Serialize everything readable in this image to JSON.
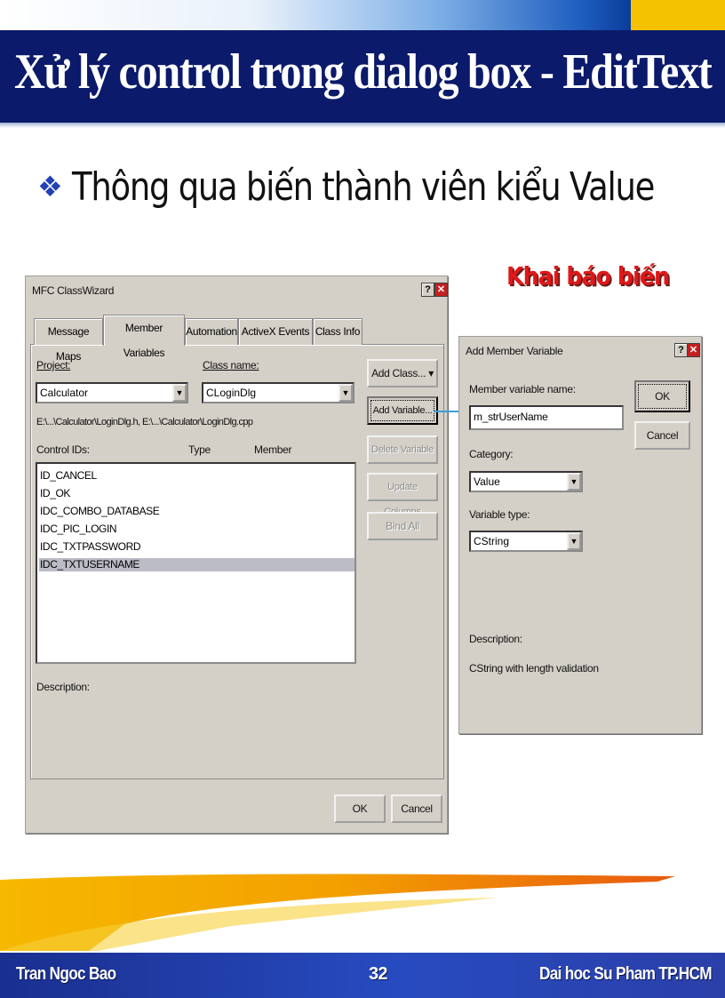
{
  "slide": {
    "title": "Xử lý control trong dialog box - EditText",
    "bullet_icon": "diamond-bullet-icon",
    "bullet": "Thông qua biến thành viên kiểu Value",
    "annotation": "Khai báo biến",
    "colors": {
      "title_bg": "#0b1a6a",
      "annotation": "#e01818",
      "footer_bg": "#274bc0",
      "accent_gold": "#f5c200"
    }
  },
  "classwizard": {
    "title": "MFC ClassWizard",
    "tabs": [
      "Message Maps",
      "Member Variables",
      "Automation",
      "ActiveX Events",
      "Class Info"
    ],
    "active_tab": "Member Variables",
    "project_label": "Project:",
    "project_value": "Calculator",
    "classname_label": "Class name:",
    "classname_value": "CLoginDlg",
    "path": "E:\\...\\Calculator\\LoginDlg.h, E:\\...\\Calculator\\LoginDlg.cpp",
    "columns": [
      "Control IDs:",
      "Type",
      "Member"
    ],
    "control_ids": [
      "ID_CANCEL",
      "ID_OK",
      "IDC_COMBO_DATABASE",
      "IDC_PIC_LOGIN",
      "IDC_TXTPASSWORD",
      "IDC_TXTUSERNAME"
    ],
    "selected": "IDC_TXTUSERNAME",
    "buttons": {
      "add_class": "Add Class...",
      "add_variable": "Add Variable...",
      "delete_variable": "Delete Variable",
      "update_columns": "Update Columns",
      "bind_all": "Bind All"
    },
    "description_label": "Description:",
    "ok": "OK",
    "cancel": "Cancel"
  },
  "add_member": {
    "title": "Add Member Variable",
    "name_label": "Member variable name:",
    "name_value": "m_strUserName",
    "category_label": "Category:",
    "category_value": "Value",
    "type_label": "Variable type:",
    "type_value": "CString",
    "description_label": "Description:",
    "description_value": "CString with length validation",
    "ok": "OK",
    "cancel": "Cancel"
  },
  "footer": {
    "author": "Tran Ngoc Bao",
    "page": "32",
    "school": "Dai hoc Su Pham TP.HCM"
  }
}
